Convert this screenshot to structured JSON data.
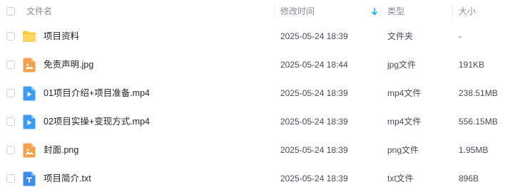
{
  "header": {
    "name_label": "文件名",
    "modified_label": "修改时间",
    "type_label": "类型",
    "size_label": "大小",
    "sort_icon": "arrow-down-icon"
  },
  "files": [
    {
      "name": "项目资料",
      "modified": "2025-05-24 18:39",
      "type": "文件夹",
      "size": "-",
      "icon": "folder-icon",
      "icon_color": "#ffc93c"
    },
    {
      "name": "免责声明.jpg",
      "modified": "2025-05-24 18:44",
      "type": "jpg文件",
      "size": "191KB",
      "icon": "image-file-icon",
      "icon_color": "#f7a04c"
    },
    {
      "name": "01项目介绍+项目准备.mp4",
      "modified": "2025-05-24 18:39",
      "type": "mp4文件",
      "size": "238.51MB",
      "icon": "video-file-icon",
      "icon_color": "#3b9cf5"
    },
    {
      "name": "02项目实操+变现方式.mp4",
      "modified": "2025-05-24 18:39",
      "type": "mp4文件",
      "size": "556.15MB",
      "icon": "video-file-icon",
      "icon_color": "#3b9cf5"
    },
    {
      "name": "封面.png",
      "modified": "2025-05-24 18:39",
      "type": "png文件",
      "size": "1.95MB",
      "icon": "image-file-icon",
      "icon_color": "#f7a04c"
    },
    {
      "name": "项目简介.txt",
      "modified": "2025-05-24 18:39",
      "type": "txt文件",
      "size": "896B",
      "icon": "text-file-icon",
      "icon_color": "#3b8cf0"
    }
  ],
  "colors": {
    "accent": "#06a7ff",
    "folder": "#ffc93c",
    "image": "#f7a04c",
    "video": "#3b9cf5",
    "text": "#3b8cf0"
  }
}
